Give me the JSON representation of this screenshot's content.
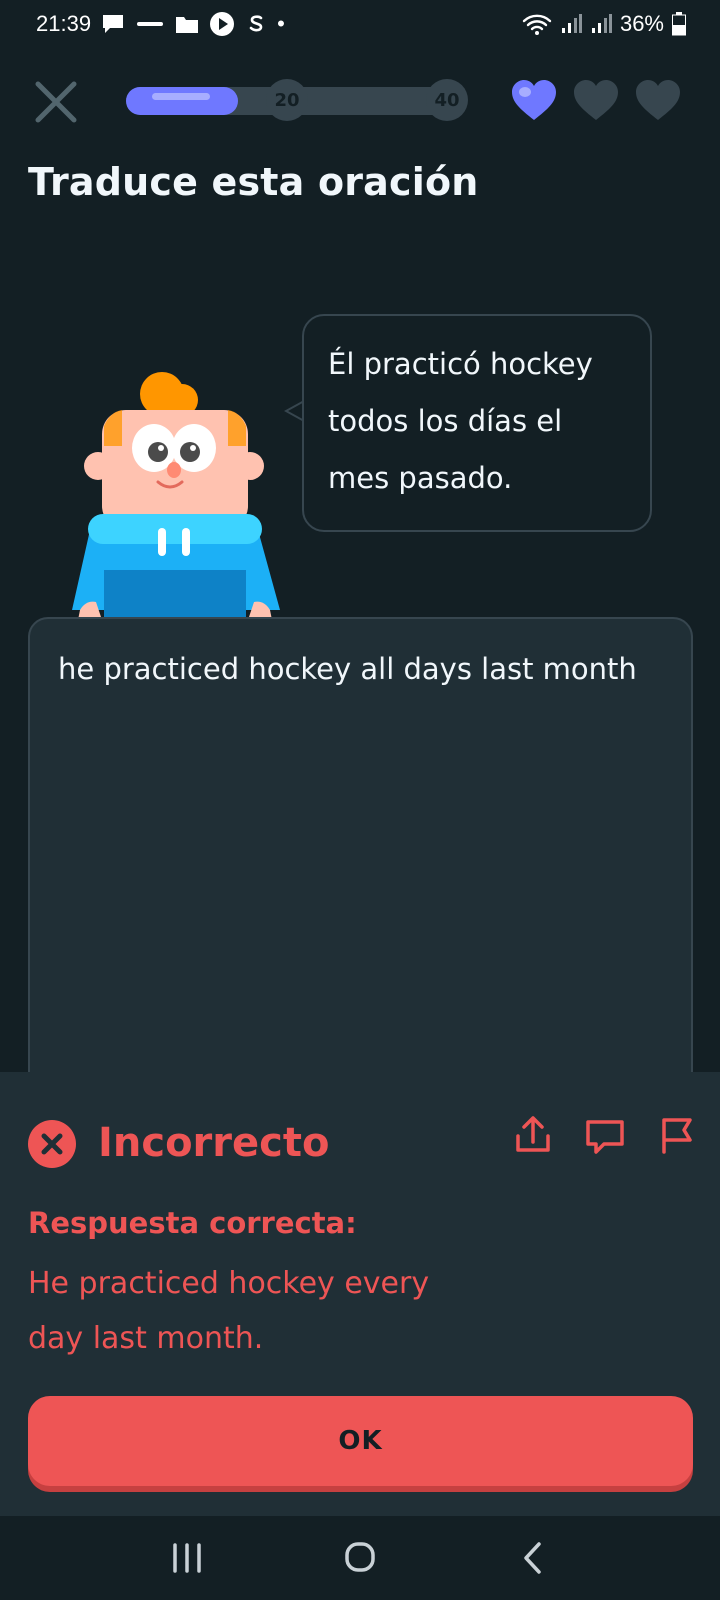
{
  "status_bar": {
    "time": "21:39",
    "battery": "36%",
    "dot": "•",
    "icons": [
      "message-icon",
      "app-icon",
      "folder-icon",
      "play-icon",
      "s-icon",
      "wifi-icon",
      "signal-icon",
      "signal-icon",
      "battery-icon"
    ]
  },
  "header": {
    "progress_fraction": 0.33,
    "milestones": [
      "20",
      "40"
    ],
    "hearts": [
      {
        "state": "active",
        "color": "#6f78ff"
      },
      {
        "state": "empty",
        "color": "#37464f"
      },
      {
        "state": "empty",
        "color": "#37464f"
      }
    ]
  },
  "exercise": {
    "title": "Traduce esta oración",
    "prompt": "Él practicó hockey todos los días el mes pasado.",
    "user_answer": "he practiced hockey all days last month"
  },
  "feedback": {
    "title": "Incorrecto",
    "correct_label": "Respuesta correcta:",
    "correct_answer": "He practiced hockey every day last month.",
    "ok_label": "OK",
    "actions": [
      "share-icon",
      "comment-icon",
      "flag-icon"
    ]
  },
  "colors": {
    "background": "#131f24",
    "panel": "#202f36",
    "border": "#37464f",
    "accent": "#6f78ff",
    "error": "#ee5555"
  }
}
